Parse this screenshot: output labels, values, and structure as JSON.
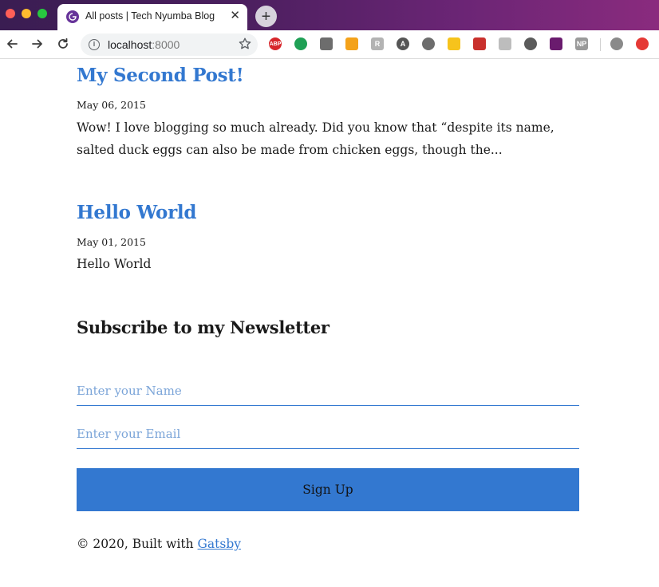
{
  "browser": {
    "tab_title": "All posts | Tech Nyumba Blog",
    "tab_close": "✕",
    "new_tab": "+",
    "url_host": "localhost",
    "url_port": ":8000"
  },
  "extensions": [
    {
      "name": "adblock-plus-icon",
      "label": "ABP",
      "color": "#d7262b"
    },
    {
      "name": "evernote-icon",
      "label": "",
      "color": "#1fa055"
    },
    {
      "name": "angular-devtools-icon",
      "label": "",
      "color": "#6d6d6d"
    },
    {
      "name": "rss-plus-icon",
      "label": "",
      "color": "#f4a21a"
    },
    {
      "name": "rewriter-icon",
      "label": "R",
      "color": "#b3b3b3"
    },
    {
      "name": "a-extension-icon",
      "label": "A",
      "color": "#555555"
    },
    {
      "name": "dark-mode-icon",
      "label": "",
      "color": "#6d6d6d"
    },
    {
      "name": "yellow-extension-icon",
      "label": "",
      "color": "#f6c31c"
    },
    {
      "name": "red-puzzle-extension-icon",
      "label": "",
      "color": "#c9302c"
    },
    {
      "name": "gray-extension-icon",
      "label": "",
      "color": "#bdbdbd"
    },
    {
      "name": "circle-extension-icon",
      "label": "",
      "color": "#5b5b5b"
    },
    {
      "name": "purple-stats-icon",
      "label": "",
      "color": "#6a1b6e"
    },
    {
      "name": "np-extension-icon",
      "label": "NP",
      "color": "#9a9a9a"
    },
    {
      "name": "profile-avatar-icon",
      "label": "",
      "color": "#8a8a8a"
    },
    {
      "name": "update-arrow-icon",
      "label": "",
      "color": "#e53935"
    }
  ],
  "posts": [
    {
      "title": "My Second Post!",
      "date": "May 06, 2015",
      "excerpt": "Wow! I love blogging so much already. Did you know that “despite its name, salted duck eggs can also be made from chicken eggs, though the..."
    },
    {
      "title": "Hello World",
      "date": "May 01, 2015",
      "excerpt": "Hello World"
    }
  ],
  "newsletter": {
    "heading": "Subscribe to my Newsletter",
    "name_placeholder": "Enter your Name",
    "email_placeholder": "Enter your Email",
    "button_label": "Sign Up"
  },
  "footer": {
    "prefix": "© 2020, Built with ",
    "link_label": "Gatsby"
  },
  "colors": {
    "accent": "#3378d0",
    "placeholder": "#7aa4d8"
  }
}
